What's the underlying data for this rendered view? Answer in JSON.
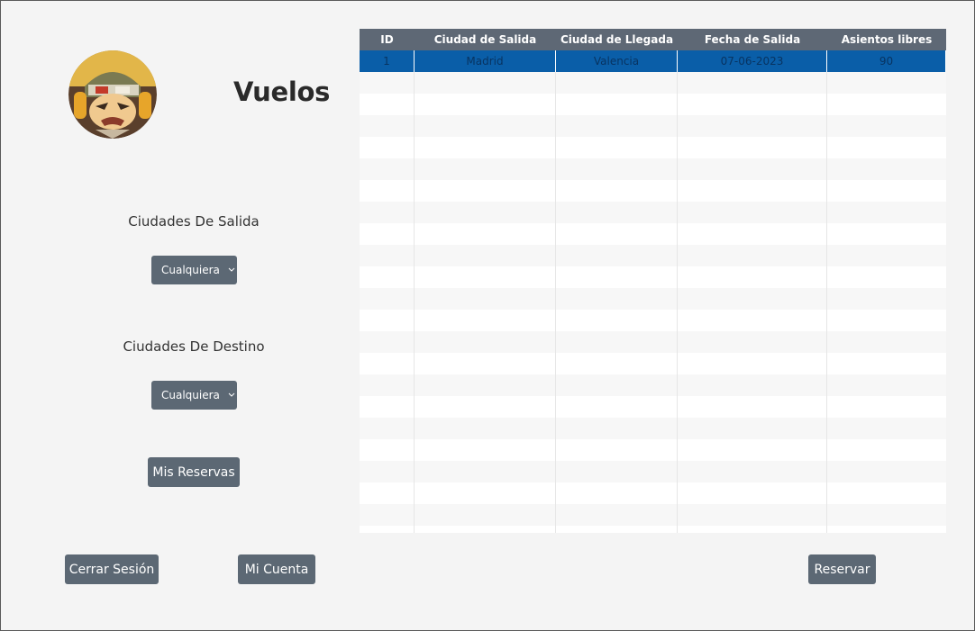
{
  "page": {
    "title": "Vuelos"
  },
  "filters": {
    "departure_label": "Ciudades De Salida",
    "departure_value": "Cualquiera",
    "destination_label": "Ciudades De Destino",
    "destination_value": "Cualquiera"
  },
  "buttons": {
    "my_reservations": "Mis Reservas",
    "logout": "Cerrar Sesión",
    "my_account": "Mi Cuenta",
    "reserve": "Reservar"
  },
  "icons": {
    "avatar": "avatar-image",
    "combo": "chevron-down-icon"
  },
  "colors": {
    "button_bg": "#5c6874",
    "header_bg": "#5e6875",
    "selected_row": "#0a5ea8"
  },
  "table": {
    "columns": [
      "ID",
      "Ciudad de Salida",
      "Ciudad de Llegada",
      "Fecha de Salida",
      "Asientos libres"
    ],
    "rows": [
      [
        "1",
        "Madrid",
        "Valencia",
        "07-06-2023",
        "90"
      ]
    ],
    "selected_row": 0
  }
}
